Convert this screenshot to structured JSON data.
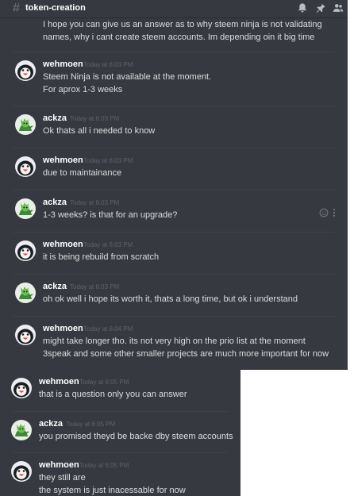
{
  "channel": {
    "hash": "#",
    "name": "token-creation"
  },
  "header_icons": [
    "bell-icon",
    "pin-icon",
    "members-icon"
  ],
  "messages_top": [
    {
      "author": "",
      "time": "",
      "avatar": "",
      "lines": [
        "I hope you can give us an answer as to why steem ninja is not validating",
        "names, why i cant create steem accounts. Im depending oin it big time"
      ]
    },
    {
      "author": "wehmoen",
      "time": "Today at 6:03 PM",
      "avatar": "penguin",
      "lines": [
        "Steem Ninja is not available at the moment.",
        "For aprox 1-3 weeks"
      ]
    },
    {
      "author": "ackza",
      "time": "Today at 6:03 PM",
      "avatar": "creature",
      "lines": [
        "Ok thats all i needed to know"
      ]
    },
    {
      "author": "wehmoen",
      "time": "Today at 6:03 PM",
      "avatar": "penguin",
      "lines": [
        "due to maintainance"
      ]
    },
    {
      "author": "ackza",
      "time": "Today at 6:03 PM",
      "avatar": "creature",
      "lines": [
        "1-3 weeks? is that for an upgrade?"
      ]
    },
    {
      "author": "wehmoen",
      "time": "Today at 6:03 PM",
      "avatar": "penguin",
      "lines": [
        "it is being rebuild from scratch"
      ]
    },
    {
      "author": "ackza",
      "time": "Today at 6:03 PM",
      "avatar": "creature",
      "lines": [
        "oh ok well i hope its worth it, thats a long time, but ok i understand"
      ]
    },
    {
      "author": "wehmoen",
      "time": "Today at 6:04 PM",
      "avatar": "penguin",
      "lines": [
        "might take longer tho. its not very high on the prio list at the moment",
        "3speak and some other smaller projects are much more important for now"
      ]
    }
  ],
  "messages_bottom": [
    {
      "author": "wehmoen",
      "time": "Today at 6:05 PM",
      "avatar": "penguin",
      "lines": [
        "that is a question only you can answer"
      ]
    },
    {
      "author": "ackza",
      "time": "Today at 6:05 PM",
      "avatar": "creature",
      "lines": [
        "you promised theyd be backe dby steem accounts"
      ]
    },
    {
      "author": "wehmoen",
      "time": "Today at 6:05 PM",
      "avatar": "penguin",
      "lines": [
        "they still are",
        "the system is just inacessable for now"
      ]
    }
  ],
  "hover_actions": [
    "add-reaction-icon",
    "more-options-icon"
  ],
  "colors": {
    "background": "#36393f",
    "text": "#dcddde",
    "author": "#ffffff",
    "timestamp": "#5f6269",
    "page": "#ffffff"
  }
}
